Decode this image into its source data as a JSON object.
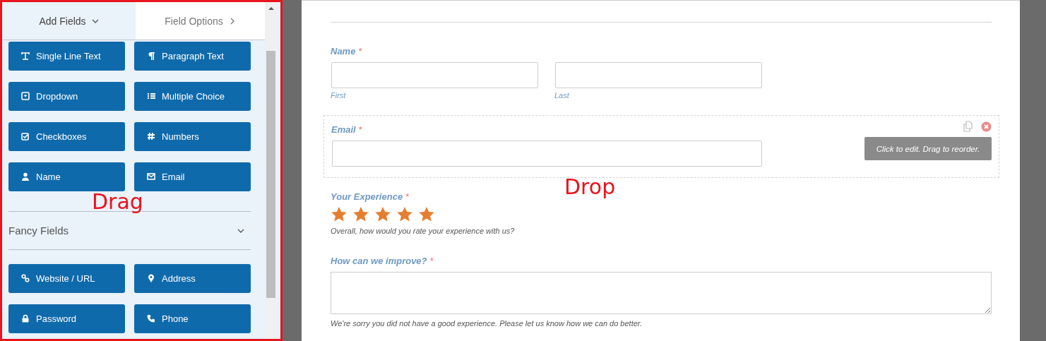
{
  "builder_tabs": [
    {
      "label": "Add Fields",
      "selected": true
    },
    {
      "label": "Field Options",
      "selected": false
    }
  ],
  "standard_fields": [
    {
      "kind": "text",
      "label": "Single Line Text"
    },
    {
      "kind": "paragraph",
      "label": "Paragraph Text"
    },
    {
      "kind": "dropdown",
      "label": "Dropdown"
    },
    {
      "kind": "list",
      "label": "Multiple Choice"
    },
    {
      "kind": "checkbox",
      "label": "Checkboxes"
    },
    {
      "kind": "number",
      "label": "Numbers"
    },
    {
      "kind": "person",
      "label": "Name"
    },
    {
      "kind": "envelope",
      "label": "Email"
    }
  ],
  "fancy_section": {
    "title": "Fancy Fields",
    "expanded": true
  },
  "fancy_fields": [
    {
      "kind": "link",
      "label": "Website / URL"
    },
    {
      "kind": "pin",
      "label": "Address"
    },
    {
      "kind": "lock",
      "label": "Password"
    },
    {
      "kind": "phone",
      "label": "Phone"
    }
  ],
  "annotations": [
    {
      "text": "Drag"
    },
    {
      "text": "Drop"
    }
  ],
  "form": {
    "fields": [
      {
        "kind": "name",
        "label": "Name",
        "required_mark": "*",
        "hovered": false,
        "sublabels": [
          "First",
          "Last"
        ]
      },
      {
        "kind": "email",
        "label": "Email",
        "required_mark": "*",
        "hovered": true,
        "tooltip": "Click to edit. Drag to reorder."
      },
      {
        "kind": "rating",
        "label": "Your Experience",
        "required_mark": "*",
        "hovered": false,
        "stars": 5,
        "description": "Overall, how would you rate your experience with us?"
      },
      {
        "kind": "textarea",
        "label": "How can we improve?",
        "required_mark": "*",
        "hovered": false,
        "description": "We're sorry you did not have a good experience. Please let us know how we can do better."
      }
    ]
  }
}
